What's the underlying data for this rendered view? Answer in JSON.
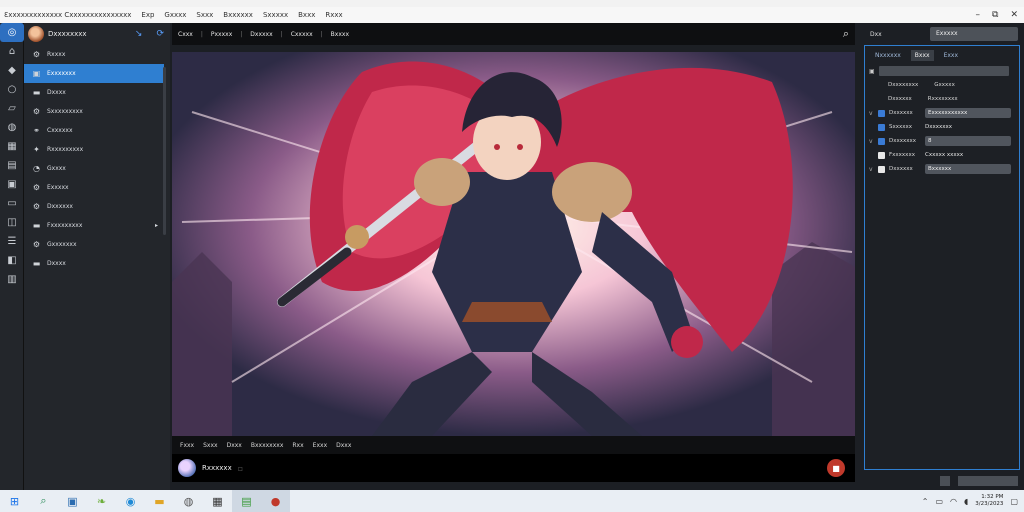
{
  "app": {
    "title": "Ɛxxxxxxxxxxxxx Cxxxxxxxxxxxxxxx",
    "menu": [
      "Exp",
      "Gxxxx",
      "Sxxx",
      "Bxxxxxx",
      "Sxxxxx",
      "Bxxx",
      "Rxxx"
    ],
    "window_controls": [
      "–",
      "⧉",
      "✕"
    ]
  },
  "activity_icons": [
    "circle-icon",
    "home-icon",
    "cube-icon",
    "record-icon",
    "layers-icon",
    "shield-icon",
    "grid-icon",
    "book-icon",
    "box-icon",
    "folder-icon",
    "image-icon",
    "sliders-icon",
    "chat-icon",
    "settings-icon"
  ],
  "sidebar": {
    "title": "Dxxxxxxxx",
    "items": [
      {
        "label": "Rxxxx",
        "icon": "gear-icon"
      },
      {
        "label": "Exxxxxxx",
        "icon": "folder-icon",
        "active": true
      },
      {
        "label": "Dxxxx",
        "icon": "folder-icon"
      },
      {
        "label": "Sxxxxxxxxx",
        "icon": "gear-icon"
      },
      {
        "label": "Cxxxxxx",
        "icon": "link-icon"
      },
      {
        "label": "Rxxxxxxxxx",
        "icon": "bolt-icon"
      },
      {
        "label": "Gxxxx",
        "icon": "clock-icon"
      },
      {
        "label": "Exxxxx",
        "icon": "gear-icon"
      },
      {
        "label": "Dxxxxxx",
        "icon": "gear-icon"
      },
      {
        "label": "Fxxxxxxxxx",
        "icon": "folder-icon"
      },
      {
        "label": "Gxxxxxxx",
        "icon": "gear-icon"
      },
      {
        "label": "Dxxxx",
        "icon": "folder-icon"
      }
    ]
  },
  "toolbar": {
    "items": [
      "Cxxx",
      "Pxxxxx",
      "Dxxxxx",
      "Cxxxxx",
      "Bxxxx"
    ]
  },
  "controls": [
    "Fxxx",
    "Sxxx",
    "Dxxx",
    "Bxxxxxxxx",
    "Rxx",
    "Exxx",
    "Dxxx"
  ],
  "player": {
    "label": "Rxxxxxx"
  },
  "right_panel": {
    "top_label": "Dxx",
    "top_value": "Exxxxx",
    "tabs": [
      "Nxxxxxx",
      "Bxxx",
      "Exxx"
    ],
    "rows": [
      {
        "label": "Dxxxxxxxx",
        "value": "Gxxxxx"
      },
      {
        "label": "Dxxxxxx",
        "value": "Rxxxxxxxx",
        "boxed": false
      },
      {
        "label": "Dxxxxxx",
        "value": "Exxxxxxxxxxx",
        "boxed": true
      },
      {
        "label": "Sxxxxxx",
        "value": "Dxxxxxxx",
        "boxed": false
      },
      {
        "label": "Dxxxxxxx",
        "value": "8",
        "boxed": true
      },
      {
        "label": "Fxxxxxxx",
        "value": "Cxxxxx xxxxx",
        "boxed": false
      },
      {
        "label": "Dxxxxxx",
        "value": "Bxxxxxx",
        "boxed": true
      }
    ]
  },
  "tray": {
    "time": "1:32 PM",
    "date": "3/23/2023"
  }
}
